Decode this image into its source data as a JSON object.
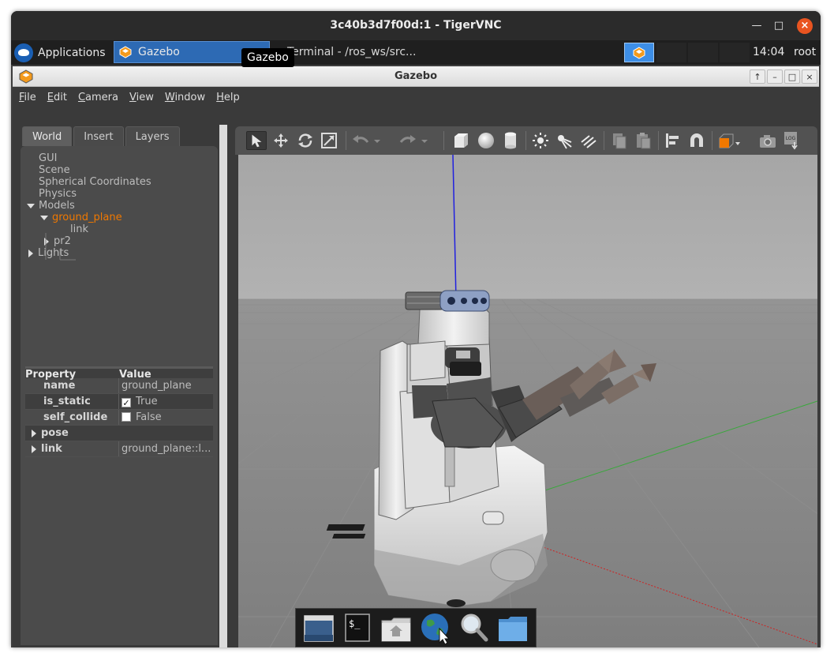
{
  "vnc": {
    "title": "3c40b3d7f00d:1 - TigerVNC"
  },
  "panel": {
    "applications_label": "Applications",
    "task_gazebo_label": "Gazebo",
    "task_terminal_label": "Terminal - /ros_ws/src...",
    "tooltip": "Gazebo",
    "clock": "14:04",
    "user": "root"
  },
  "gazebo": {
    "title": "Gazebo",
    "menu": {
      "file": {
        "u": "F",
        "rest": "ile"
      },
      "edit": {
        "u": "E",
        "rest": "dit"
      },
      "camera": {
        "u": "C",
        "rest": "amera"
      },
      "view": {
        "u": "V",
        "rest": "iew"
      },
      "window": {
        "u": "W",
        "rest": "indow"
      },
      "help": {
        "u": "H",
        "rest": "elp"
      }
    },
    "tabs": {
      "world": "World",
      "insert": "Insert",
      "layers": "Layers"
    },
    "tree": {
      "gui": "GUI",
      "scene": "Scene",
      "spherical": "Spherical Coordinates",
      "physics": "Physics",
      "models": "Models",
      "ground_plane": "ground_plane",
      "link": "link",
      "pr2": "pr2",
      "lights": "Lights"
    },
    "properties": {
      "header_property": "Property",
      "header_value": "Value",
      "rows": [
        {
          "key": "name",
          "value": "ground_plane"
        },
        {
          "key": "is_static",
          "value": "True",
          "checked": true
        },
        {
          "key": "self_collide",
          "value": "False",
          "checked": false
        },
        {
          "key": "pose",
          "value": ""
        },
        {
          "key": "link",
          "value": "ground_plane::l..."
        }
      ]
    }
  },
  "colors": {
    "accent_orange": "#f07800",
    "xfce_blue": "#2d6ab4",
    "close_red": "#e95420"
  },
  "icons": {
    "toolbar": [
      "select-arrow-icon",
      "translate-icon",
      "rotate-icon",
      "scale-icon",
      "undo-icon",
      "redo-icon",
      "box-icon",
      "sphere-icon",
      "cylinder-icon",
      "point-light-icon",
      "spot-light-icon",
      "directional-light-icon",
      "copy-icon",
      "paste-icon",
      "align-icon",
      "snap-magnet-icon",
      "view-angle-icon",
      "screenshot-camera-icon",
      "log-icon"
    ],
    "dock": [
      "desktop-icon",
      "terminal-icon",
      "home-folder-icon",
      "web-browser-icon",
      "search-magnifier-icon",
      "folder-icon"
    ]
  }
}
